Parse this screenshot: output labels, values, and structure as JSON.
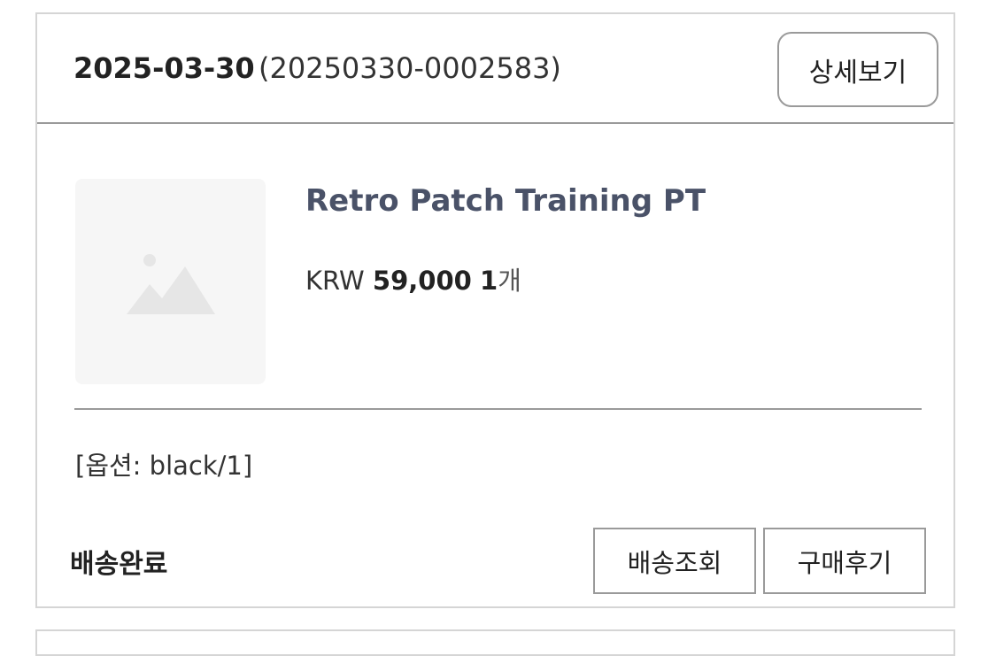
{
  "order": {
    "date": "2025-03-30",
    "number": "(20250330-0002583)",
    "detail_label": "상세보기"
  },
  "product": {
    "name": "Retro Patch Training PT",
    "currency": "KRW",
    "price": "59,000",
    "qty_number": "1",
    "qty_unit": "개",
    "option": "[옵션: black/1]",
    "thumbnail_icon": "image-placeholder-icon"
  },
  "footer": {
    "status": "배송완료",
    "track_label": "배송조회",
    "review_label": "구매후기"
  },
  "colors": {
    "product_name": "#4a5268",
    "border": "#9a9a9a",
    "card_border": "#d5d5d5",
    "thumb_bg": "#f6f6f6"
  }
}
